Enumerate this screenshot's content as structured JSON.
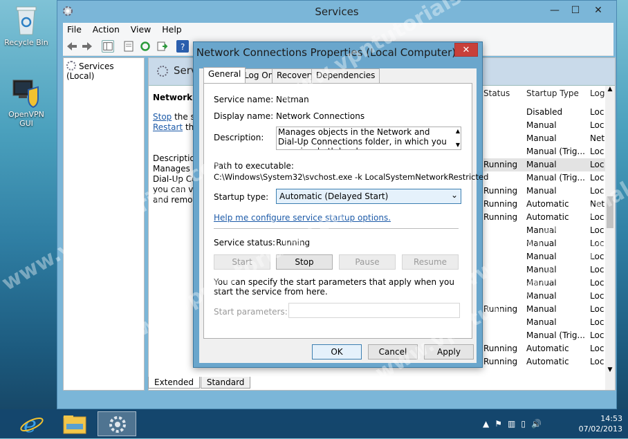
{
  "desktop": {
    "icons": [
      {
        "label": "Recycle Bin"
      },
      {
        "label": "OpenVPN GUI"
      }
    ]
  },
  "services_window": {
    "title": "Services",
    "menu": [
      "File",
      "Action",
      "View",
      "Help"
    ],
    "tree_node": "Services (Local)",
    "header_title": "Servi",
    "desc": {
      "name": "Network C",
      "stop_link": "Stop",
      "stop_rest": " the ser",
      "restart_link": "Restart",
      "restart_rest": " the",
      "lines": [
        "Description",
        "Manages ol",
        "Dial-Up Cor",
        "you can vie",
        "and remote"
      ]
    },
    "columns": {
      "status": "Status",
      "startup": "Startup Type",
      "logon": "Log"
    },
    "rows": [
      {
        "status": "",
        "startup": "Disabled",
        "logon": "Loc"
      },
      {
        "status": "",
        "startup": "Manual",
        "logon": "Loc"
      },
      {
        "status": "",
        "startup": "Manual",
        "logon": "Net"
      },
      {
        "status": "",
        "startup": "Manual (Trig...",
        "logon": "Loc"
      },
      {
        "status": "Running",
        "startup": "Manual",
        "logon": "Loc"
      },
      {
        "status": "",
        "startup": "Manual (Trig...",
        "logon": "Loc"
      },
      {
        "status": "Running",
        "startup": "Manual",
        "logon": "Loc"
      },
      {
        "status": "Running",
        "startup": "Automatic",
        "logon": "Net"
      },
      {
        "status": "Running",
        "startup": "Automatic",
        "logon": "Loc"
      },
      {
        "status": "",
        "startup": "Manual",
        "logon": "Loc"
      },
      {
        "status": "",
        "startup": "Manual",
        "logon": "Loc"
      },
      {
        "status": "",
        "startup": "Manual",
        "logon": "Loc"
      },
      {
        "status": "",
        "startup": "Manual",
        "logon": "Loc"
      },
      {
        "status": "",
        "startup": "Manual",
        "logon": "Loc"
      },
      {
        "status": "",
        "startup": "Manual",
        "logon": "Loc"
      },
      {
        "status": "Running",
        "startup": "Manual",
        "logon": "Loc"
      },
      {
        "status": "",
        "startup": "Manual",
        "logon": "Loc"
      },
      {
        "status": "",
        "startup": "Manual (Trig...",
        "logon": "Loc"
      },
      {
        "status": "Running",
        "startup": "Automatic",
        "logon": "Loc"
      },
      {
        "status": "Running",
        "startup": "Automatic",
        "logon": "Loc"
      }
    ],
    "bottom_tabs": [
      "Extended",
      "Standard"
    ]
  },
  "dialog": {
    "title": "Network Connections Properties (Local Computer)",
    "close": "✕",
    "tabs": [
      "General",
      "Log On",
      "Recovery",
      "Dependencies"
    ],
    "service_name_label": "Service name:",
    "service_name": "Netman",
    "display_name_label": "Display name:",
    "display_name": "Network Connections",
    "description_label": "Description:",
    "description": "Manages objects in the Network and Dial-Up Connections folder, in which you can view both local",
    "path_label": "Path to executable:",
    "path": "C:\\Windows\\System32\\svchost.exe -k LocalSystemNetworkRestricted",
    "startup_label": "Startup type:",
    "startup_value": "Automatic (Delayed Start)",
    "help_link": "Help me configure service startup options.",
    "status_label": "Service status:",
    "status_value": "Running",
    "buttons": {
      "start": "Start",
      "stop": "Stop",
      "pause": "Pause",
      "resume": "Resume"
    },
    "params_text": "You can specify the start parameters that apply when you start the service from here.",
    "params_label": "Start parameters:",
    "ok": "OK",
    "cancel": "Cancel",
    "apply": "Apply"
  },
  "taskbar": {
    "time": "14:53",
    "date": "07/02/2013"
  },
  "watermark": "www.vpntutorials.com",
  "colors": {
    "accent": "#6aa6cc",
    "close": "#c8403a",
    "link": "#1c5aa8"
  }
}
